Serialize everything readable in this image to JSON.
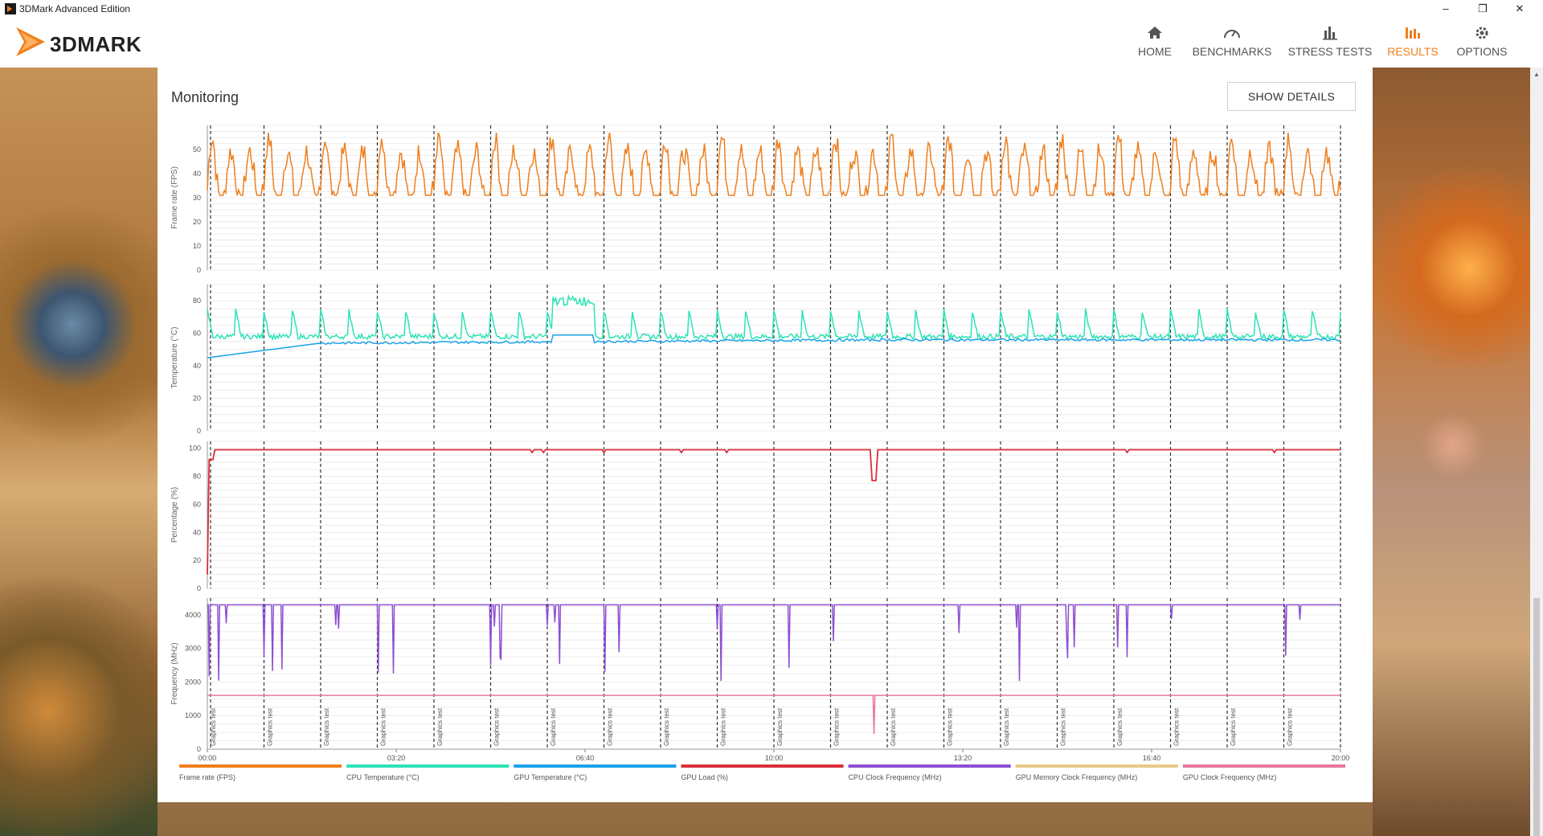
{
  "window": {
    "title": "3DMark Advanced Edition",
    "minimize_icon": "–",
    "restore_icon": "❐",
    "close_icon": "✕"
  },
  "header": {
    "logo_text": "3DMARK",
    "nav": [
      {
        "label": "HOME",
        "icon": "home-icon"
      },
      {
        "label": "BENCHMARKS",
        "icon": "gauge-icon"
      },
      {
        "label": "STRESS TESTS",
        "icon": "bar-chart-icon"
      },
      {
        "label": "RESULTS",
        "icon": "results-icon",
        "active": true
      },
      {
        "label": "OPTIONS",
        "icon": "gear-icon"
      }
    ],
    "accent_color": "#f07f1e"
  },
  "monitoring": {
    "title": "Monitoring",
    "show_details_label": "SHOW DETAILS"
  },
  "chart_data": {
    "type": "line",
    "x_ticks": [
      "00:00",
      "03:20",
      "06:40",
      "10:00",
      "13:20",
      "16:40",
      "20:00"
    ],
    "x_range_seconds": [
      0,
      1200
    ],
    "segment_label": "Graphics test",
    "segment_count": 20,
    "grid": true,
    "legend_position": "bottom",
    "panels": [
      {
        "ylabel": "Frame rate (FPS)",
        "yticks": [
          0,
          10,
          20,
          30,
          40,
          50
        ],
        "ylim": [
          0,
          60
        ],
        "series": [
          {
            "name": "Frame rate (FPS)",
            "color": "#f07f1e",
            "approx_range": [
              31,
              57
            ]
          }
        ]
      },
      {
        "ylabel": "Temperature (°C)",
        "yticks": [
          0,
          20,
          40,
          60,
          80
        ],
        "ylim": [
          0,
          90
        ],
        "series": [
          {
            "name": "CPU Temperature (°C)",
            "color": "#2de3b6",
            "approx_range": [
              55,
              85
            ]
          },
          {
            "name": "GPU Temperature (°C)",
            "color": "#1aa3e8",
            "approx_range": [
              45,
              60
            ]
          }
        ]
      },
      {
        "ylabel": "Percentage (%)",
        "yticks": [
          0,
          20,
          40,
          60,
          80,
          100
        ],
        "ylim": [
          0,
          105
        ],
        "series": [
          {
            "name": "GPU Load (%)",
            "color": "#d9303a",
            "approx_value": 99
          }
        ]
      },
      {
        "ylabel": "Frequency (MHz)",
        "yticks": [
          0,
          1000,
          2000,
          3000,
          4000
        ],
        "ylim": [
          0,
          4500
        ],
        "series": [
          {
            "name": "CPU Clock Frequency (MHz)",
            "color": "#8e4fd4",
            "approx_value": 4300,
            "dips_to": 1900
          },
          {
            "name": "GPU Memory Clock Frequency (MHz)",
            "color": "#e8c98a"
          },
          {
            "name": "GPU Clock Frequency (MHz)",
            "color": "#e8779a",
            "approx_value": 1600
          }
        ]
      }
    ],
    "legend": [
      {
        "name": "Frame rate (FPS)",
        "color": "#f07f1e"
      },
      {
        "name": "CPU Temperature (°C)",
        "color": "#2de3b6"
      },
      {
        "name": "GPU Temperature (°C)",
        "color": "#1aa3e8"
      },
      {
        "name": "GPU Load (%)",
        "color": "#d9303a"
      },
      {
        "name": "CPU Clock Frequency (MHz)",
        "color": "#8e4fd4"
      },
      {
        "name": "GPU Memory Clock Frequency (MHz)",
        "color": "#e8c98a"
      },
      {
        "name": "GPU Clock Frequency (MHz)",
        "color": "#e8779a"
      }
    ]
  }
}
